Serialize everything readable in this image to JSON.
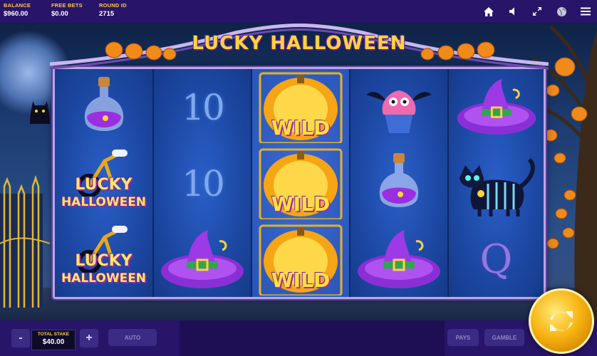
{
  "top_bar": {
    "balance_label": "BALANCE",
    "balance_value": "$960.00",
    "free_bets_label": "FREE BETS",
    "free_bets_value": "$0.00",
    "round_id_label": "ROUND ID",
    "round_id_value": "2715",
    "icons": [
      "home-icon",
      "sound-icon",
      "fullscreen-icon",
      "info-globe-icon",
      "menu-icon"
    ]
  },
  "game": {
    "logo_text": "LUCKY HALLOWEEN",
    "reels": [
      {
        "symbols": [
          {
            "type": "potion"
          },
          {
            "type": "lucky-halloween",
            "text_top": "LUCKY",
            "text_bottom": "HALLOWEEN"
          },
          {
            "type": "lucky-halloween",
            "text_top": "LUCKY",
            "text_bottom": "HALLOWEEN"
          }
        ]
      },
      {
        "symbols": [
          {
            "type": "ten",
            "text": "10"
          },
          {
            "type": "ten",
            "text": "10"
          },
          {
            "type": "witch-hat"
          }
        ]
      },
      {
        "symbols": [
          {
            "type": "wild",
            "text": "WILD"
          },
          {
            "type": "wild",
            "text": "WILD"
          },
          {
            "type": "wild",
            "text": "WILD"
          }
        ]
      },
      {
        "symbols": [
          {
            "type": "cupcake"
          },
          {
            "type": "potion"
          },
          {
            "type": "witch-hat"
          }
        ]
      },
      {
        "symbols": [
          {
            "type": "witch-hat"
          },
          {
            "type": "cat"
          },
          {
            "type": "queen",
            "text": "Q"
          }
        ]
      }
    ]
  },
  "bottom_bar": {
    "minus_label": "-",
    "plus_label": "+",
    "total_stake_label": "TOTAL STAKE",
    "total_stake_value": "$40.00",
    "auto_label": "AUTO",
    "pays_label": "PAYS",
    "gamble_label": "GAMBLE"
  },
  "colors": {
    "bar": "#281468",
    "accent": "#ffcd38",
    "spin": "#f8b614"
  }
}
